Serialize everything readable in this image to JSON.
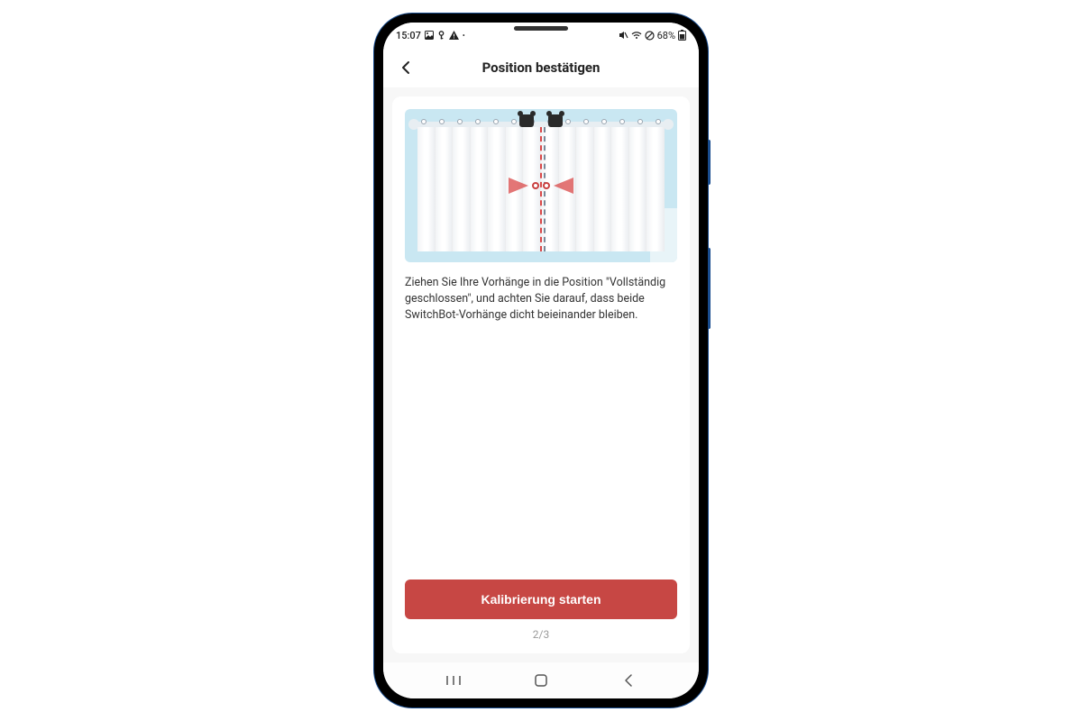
{
  "status": {
    "time": "15:07",
    "battery_text": "68%",
    "icons_left": [
      "image-icon",
      "key-icon",
      "warning-icon",
      "dot-icon"
    ],
    "icons_right": [
      "mute-icon",
      "wifi-icon",
      "no-data-icon"
    ]
  },
  "header": {
    "title": "Position bestätigen"
  },
  "instruction": "Ziehen Sie Ihre Vorhänge in die Position \"Vollständig geschlossen\", und achten Sie darauf, dass beide SwitchBot-Vorhänge dicht beieinander bleiben.",
  "button": {
    "primary_label": "Kalibrierung starten"
  },
  "step": "2/3",
  "colors": {
    "accent": "#c74744"
  }
}
